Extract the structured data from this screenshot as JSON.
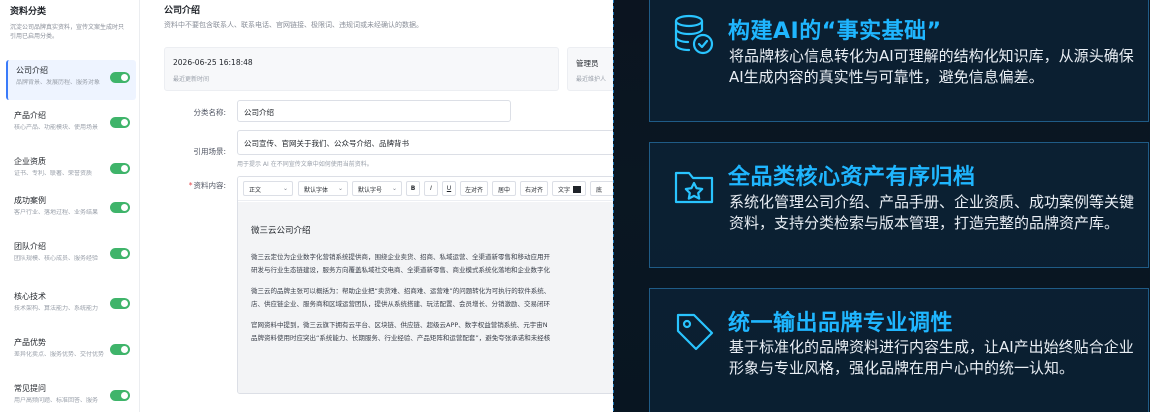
{
  "sidebar": {
    "title": "资料分类",
    "description": "沉淀公司品牌真实资料，宣传文案生成时只引用已启用分类。",
    "items": [
      {
        "label": "公司介绍",
        "sub": "品牌背景、发展历程、服务对象",
        "enabled": true
      },
      {
        "label": "产品介绍",
        "sub": "核心产品、功能模块、使用场景",
        "enabled": true
      },
      {
        "label": "企业资质",
        "sub": "证书、专利、联著、荣誉资质",
        "enabled": true
      },
      {
        "label": "成功案例",
        "sub": "客户行业、落地过程、业务结果",
        "enabled": true
      },
      {
        "label": "团队介绍",
        "sub": "团队规模、核心成员、服务经验",
        "enabled": true
      },
      {
        "label": "核心技术",
        "sub": "技术架构、算法能力、系统能力",
        "enabled": true
      },
      {
        "label": "产品优势",
        "sub": "差异化卖点、服务优势、交付优势",
        "enabled": true
      },
      {
        "label": "常见提问",
        "sub": "用户高频问题、标准回答、服务",
        "enabled": true
      }
    ]
  },
  "main": {
    "title": "公司介绍",
    "description": "资料中不要包含联系人、联系电话、官网链接、极限词、违规词或未经确认的数据。",
    "updated_time": "2026-06-25 16:18:48",
    "updated_time_label": "最近更新时间",
    "maintainer": "管理员",
    "maintainer_label": "最近维护人",
    "form": {
      "name_label": "分类名称:",
      "name_value": "公司介绍",
      "scene_label": "引用场景:",
      "scene_value": "公司宣传、官网关于我们、公众号介绍、品牌背书",
      "scene_hint": "用于提示 AI 在不同宣传文章中如何使用当前资料。",
      "content_label": "资料内容:"
    },
    "toolbar": {
      "paragraph": "正文",
      "font": "默认字体",
      "size": "默认字号",
      "bold": "B",
      "italic": "I",
      "underline": "U",
      "align_left": "左对齐",
      "align_center": "居中",
      "align_right": "右对齐",
      "text_color": "文字",
      "bg_color": "底"
    },
    "editor": {
      "heading": "微三云公司介绍",
      "paragraphs": [
        [
          "微三云定位为企业数字化营销系统提供商，围绕企业卖货、招商、私域运营、全渠道新零售和移动应用开",
          "研发与行业生态链建设，服务方向覆盖私域社交电商、全渠道新零售、商业模式系统化落地和企业数字化"
        ],
        [
          "微三云的品牌主张可以概括为：帮助企业把“卖货难、招商难、运营难”的问题转化为可执行的软件系统、",
          "店、供应链企业、服务商和区域运营团队，提供从系统搭建、玩法配置、会员增长、分销激励、交易闭环"
        ],
        [
          "官网资料中提到，微三云旗下拥有云平台、区块链、供应链、超级云APP、数字权益营销系统、元宇宙N",
          "品牌资料使用时应突出“系统能力、长期服务、行业经验、产品矩阵和运营配套”，避免夸张承诺和未经核"
        ]
      ]
    }
  },
  "features": [
    {
      "title": "构建AI的“事实基础”",
      "description": "将品牌核心信息转化为AI可理解的结构化知识库，从源头确保AI生成内容的真实性与可靠性，避免信息偏差。",
      "icon": "database-check-icon"
    },
    {
      "title": "全品类核心资产有序归档",
      "description": "系统化管理公司介绍、产品手册、企业资质、成功案例等关键资料，支持分类检索与版本管理，打造完整的品牌资产库。",
      "icon": "folder-star-icon"
    },
    {
      "title": "统一输出品牌专业调性",
      "description": "基于标准化的品牌资料进行内容生成，让AI产出始终贴合企业形象与专业风格，强化品牌在用户心中的统一认知。",
      "icon": "tag-icon"
    }
  ],
  "colors": {
    "accent": "#3a7bfa",
    "toggle_on": "#3fb46a",
    "feature_title": "#1fb6ff",
    "panel_bg": "#0a1722"
  }
}
